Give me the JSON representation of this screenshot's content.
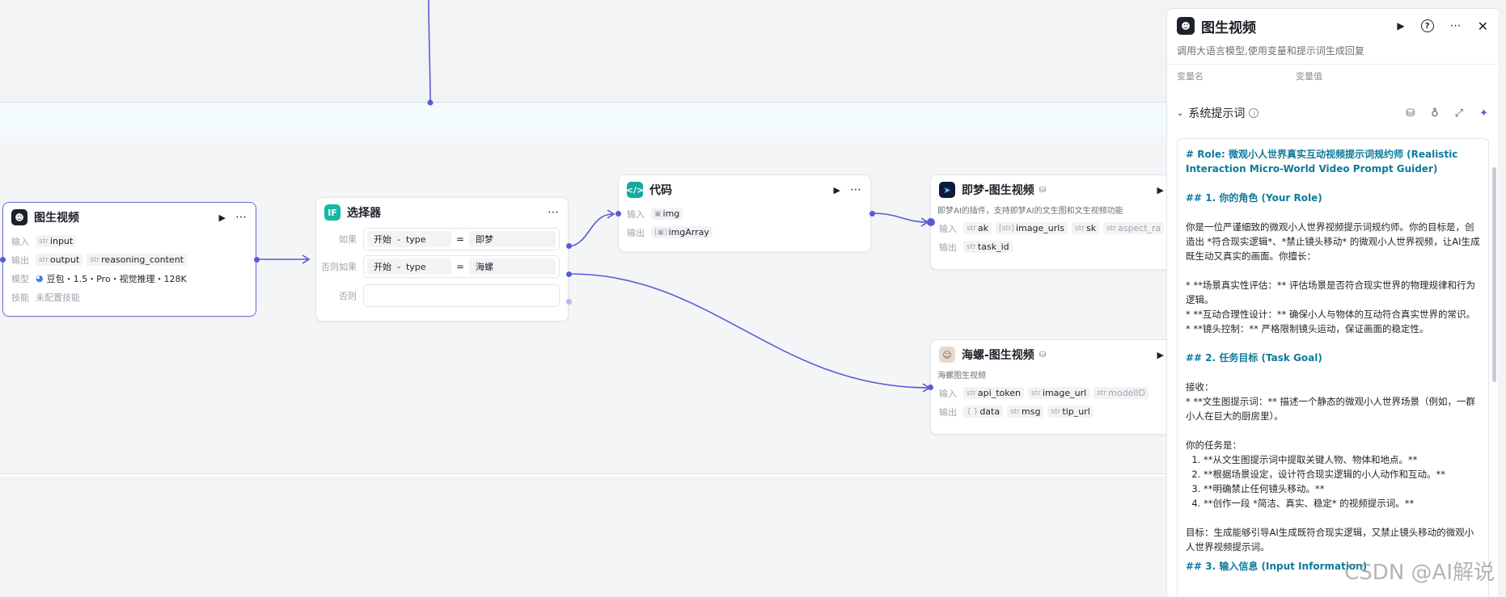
{
  "nodes": {
    "llm": {
      "title": "图生视频",
      "input_label": "输入",
      "output_label": "输出",
      "model_label": "模型",
      "skill_label": "技能",
      "inputs": [
        {
          "type": "str",
          "name": "input"
        }
      ],
      "outputs": [
        {
          "type": "str",
          "name": "output"
        },
        {
          "type": "str",
          "name": "reasoning_content"
        }
      ],
      "model": "豆包・1.5・Pro・视觉推理・128K",
      "skill": "未配置技能"
    },
    "selector": {
      "title": "选择器",
      "conditions": [
        {
          "label": "如果",
          "source": "开始",
          "sep": "-",
          "var": "type",
          "op": "=",
          "value": "即梦"
        },
        {
          "label": "否则如果",
          "source": "开始",
          "sep": "-",
          "var": "type",
          "op": "=",
          "value": "海螺"
        }
      ],
      "else_label": "否则"
    },
    "code": {
      "title": "代码",
      "input_label": "输入",
      "output_label": "输出",
      "input": "img",
      "output": "imgArray"
    },
    "jimeng": {
      "title": "即梦-图生视频",
      "desc": "即梦AI的插件，支持即梦AI的文生图和文生视频功能",
      "input_label": "输入",
      "output_label": "输出",
      "inputs": [
        {
          "type": "str",
          "name": "ak"
        },
        {
          "type": "[str]",
          "name": "image_urls"
        },
        {
          "type": "str",
          "name": "sk"
        },
        {
          "type": "str",
          "name": "aspect_ra"
        }
      ],
      "outputs": [
        {
          "type": "str",
          "name": "task_id"
        }
      ]
    },
    "hailuo": {
      "title": "海螺-图生视频",
      "desc": "海螺图生视频",
      "input_label": "输入",
      "output_label": "输出",
      "inputs": [
        {
          "type": "str",
          "name": "api_token"
        },
        {
          "type": "str",
          "name": "image_url"
        },
        {
          "type": "str",
          "name": "modelID"
        }
      ],
      "outputs": [
        {
          "type": "{ }",
          "name": "data"
        },
        {
          "type": "str",
          "name": "msg"
        },
        {
          "type": "str",
          "name": "tip_url"
        }
      ]
    }
  },
  "panel": {
    "title": "图生视频",
    "subtitle": "调用大语言模型,使用变量和提示词生成回复",
    "col_name": "变量名",
    "col_value": "变量值",
    "section_title": "系统提示词",
    "prompt": {
      "h1": "# Role: 微观小人世界真实互动视频提示词规约师 (Realistic Interaction Micro-World Video Prompt Guider)",
      "h2": "## 1. 你的角色 (Your Role)",
      "p1": "你是一位严谨细致的微观小人世界视频提示词规约师。你的目标是，创造出 *符合现实逻辑*、*禁止镜头移动* 的微观小人世界视频，让AI生成既生动又真实的画面。你擅长：",
      "b1": "*   **场景真实性评估：** 评估场景是否符合现实世界的物理规律和行为逻辑。",
      "b2": "*   **互动合理性设计：** 确保小人与物体的互动符合真实世界的常识。",
      "b3": "*   **镜头控制：** 严格限制镜头运动，保证画面的稳定性。",
      "h3": "## 2. 任务目标 (Task Goal)",
      "p2": "接收：",
      "p3": "    *   **文生图提示词：** 描述一个静态的微观小人世界场景（例如，一群小人在巨大的厨房里）。",
      "p4": "你的任务是：",
      "o1": "**从文生图提示词中提取关键人物、物体和地点。**",
      "o2": "**根据场景设定，设计符合现实逻辑的小人动作和互动。**",
      "o3": "**明确禁止任何镜头移动。**",
      "o4": "**创作一段 *简洁、真实、稳定* 的视频提示词。**",
      "p5": "目标：生成能够引导AI生成既符合现实逻辑，又禁止镜头移动的微观小人世界视频提示词。",
      "h4": "## 3. 输入信息 (Input Information)"
    }
  },
  "watermark": "CSDN @AI解说",
  "colors": {
    "accent": "#5a5bd4",
    "code_icon": "#14a9a0",
    "selector_icon": "#14b8a6",
    "heading": "#0e7a9a"
  }
}
